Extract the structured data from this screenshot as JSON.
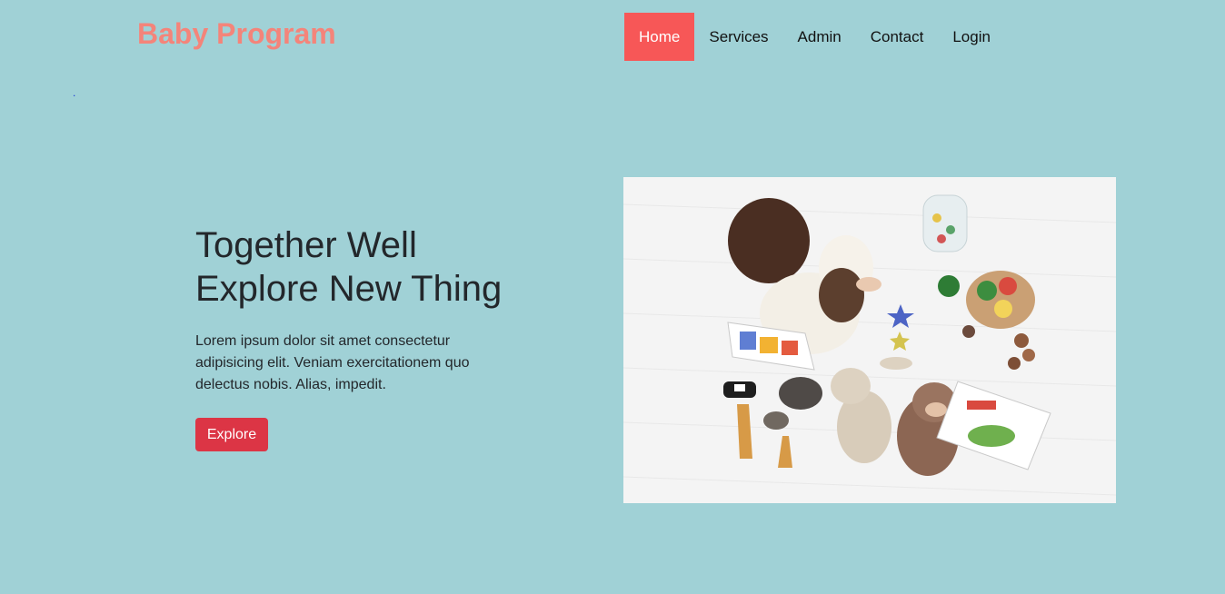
{
  "brand": {
    "name": "Baby Program"
  },
  "nav": {
    "items": [
      {
        "label": "Home",
        "active": true
      },
      {
        "label": "Services",
        "active": false
      },
      {
        "label": "Admin",
        "active": false
      },
      {
        "label": "Contact",
        "active": false
      },
      {
        "label": "Login",
        "active": false
      }
    ]
  },
  "stray_mark": ".",
  "hero": {
    "title_line1": "Together Well",
    "title_line2": "Explore New Thing",
    "paragraph": "Lorem ipsum dolor sit amet consectetur adipisicing elit. Veniam exercitationem quo delectus nobis. Alias, impedit.",
    "button_label": "Explore",
    "image_subject": "baby-playing-with-toys"
  },
  "colors": {
    "background": "#a0d1d6",
    "brand": "#f4847a",
    "nav_active": "#f75757",
    "button": "#dc3545",
    "text": "#23272b"
  }
}
